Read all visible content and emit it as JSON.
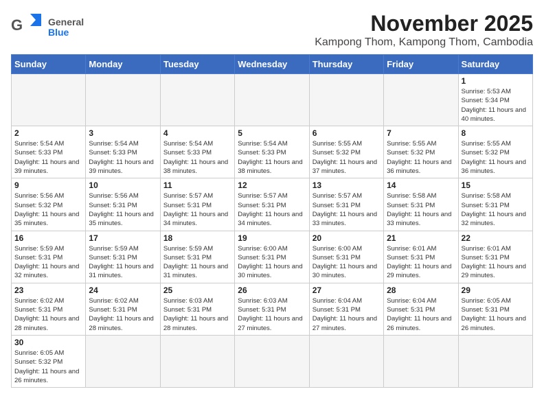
{
  "header": {
    "logo_general": "General",
    "logo_blue": "Blue",
    "title": "November 2025",
    "subtitle": "Kampong Thom, Kampong Thom, Cambodia"
  },
  "days_of_week": [
    "Sunday",
    "Monday",
    "Tuesday",
    "Wednesday",
    "Thursday",
    "Friday",
    "Saturday"
  ],
  "weeks": [
    [
      {
        "day": "",
        "empty": true
      },
      {
        "day": "",
        "empty": true
      },
      {
        "day": "",
        "empty": true
      },
      {
        "day": "",
        "empty": true
      },
      {
        "day": "",
        "empty": true
      },
      {
        "day": "",
        "empty": true
      },
      {
        "day": "1",
        "sunrise": "5:53 AM",
        "sunset": "5:34 PM",
        "daylight": "11 hours and 40 minutes."
      }
    ],
    [
      {
        "day": "2",
        "sunrise": "5:54 AM",
        "sunset": "5:33 PM",
        "daylight": "11 hours and 39 minutes."
      },
      {
        "day": "3",
        "sunrise": "5:54 AM",
        "sunset": "5:33 PM",
        "daylight": "11 hours and 39 minutes."
      },
      {
        "day": "4",
        "sunrise": "5:54 AM",
        "sunset": "5:33 PM",
        "daylight": "11 hours and 38 minutes."
      },
      {
        "day": "5",
        "sunrise": "5:54 AM",
        "sunset": "5:33 PM",
        "daylight": "11 hours and 38 minutes."
      },
      {
        "day": "6",
        "sunrise": "5:55 AM",
        "sunset": "5:32 PM",
        "daylight": "11 hours and 37 minutes."
      },
      {
        "day": "7",
        "sunrise": "5:55 AM",
        "sunset": "5:32 PM",
        "daylight": "11 hours and 36 minutes."
      },
      {
        "day": "8",
        "sunrise": "5:55 AM",
        "sunset": "5:32 PM",
        "daylight": "11 hours and 36 minutes."
      }
    ],
    [
      {
        "day": "9",
        "sunrise": "5:56 AM",
        "sunset": "5:32 PM",
        "daylight": "11 hours and 35 minutes."
      },
      {
        "day": "10",
        "sunrise": "5:56 AM",
        "sunset": "5:31 PM",
        "daylight": "11 hours and 35 minutes."
      },
      {
        "day": "11",
        "sunrise": "5:57 AM",
        "sunset": "5:31 PM",
        "daylight": "11 hours and 34 minutes."
      },
      {
        "day": "12",
        "sunrise": "5:57 AM",
        "sunset": "5:31 PM",
        "daylight": "11 hours and 34 minutes."
      },
      {
        "day": "13",
        "sunrise": "5:57 AM",
        "sunset": "5:31 PM",
        "daylight": "11 hours and 33 minutes."
      },
      {
        "day": "14",
        "sunrise": "5:58 AM",
        "sunset": "5:31 PM",
        "daylight": "11 hours and 33 minutes."
      },
      {
        "day": "15",
        "sunrise": "5:58 AM",
        "sunset": "5:31 PM",
        "daylight": "11 hours and 32 minutes."
      }
    ],
    [
      {
        "day": "16",
        "sunrise": "5:59 AM",
        "sunset": "5:31 PM",
        "daylight": "11 hours and 32 minutes."
      },
      {
        "day": "17",
        "sunrise": "5:59 AM",
        "sunset": "5:31 PM",
        "daylight": "11 hours and 31 minutes."
      },
      {
        "day": "18",
        "sunrise": "5:59 AM",
        "sunset": "5:31 PM",
        "daylight": "11 hours and 31 minutes."
      },
      {
        "day": "19",
        "sunrise": "6:00 AM",
        "sunset": "5:31 PM",
        "daylight": "11 hours and 30 minutes."
      },
      {
        "day": "20",
        "sunrise": "6:00 AM",
        "sunset": "5:31 PM",
        "daylight": "11 hours and 30 minutes."
      },
      {
        "day": "21",
        "sunrise": "6:01 AM",
        "sunset": "5:31 PM",
        "daylight": "11 hours and 29 minutes."
      },
      {
        "day": "22",
        "sunrise": "6:01 AM",
        "sunset": "5:31 PM",
        "daylight": "11 hours and 29 minutes."
      }
    ],
    [
      {
        "day": "23",
        "sunrise": "6:02 AM",
        "sunset": "5:31 PM",
        "daylight": "11 hours and 28 minutes."
      },
      {
        "day": "24",
        "sunrise": "6:02 AM",
        "sunset": "5:31 PM",
        "daylight": "11 hours and 28 minutes."
      },
      {
        "day": "25",
        "sunrise": "6:03 AM",
        "sunset": "5:31 PM",
        "daylight": "11 hours and 28 minutes."
      },
      {
        "day": "26",
        "sunrise": "6:03 AM",
        "sunset": "5:31 PM",
        "daylight": "11 hours and 27 minutes."
      },
      {
        "day": "27",
        "sunrise": "6:04 AM",
        "sunset": "5:31 PM",
        "daylight": "11 hours and 27 minutes."
      },
      {
        "day": "28",
        "sunrise": "6:04 AM",
        "sunset": "5:31 PM",
        "daylight": "11 hours and 26 minutes."
      },
      {
        "day": "29",
        "sunrise": "6:05 AM",
        "sunset": "5:31 PM",
        "daylight": "11 hours and 26 minutes."
      }
    ],
    [
      {
        "day": "30",
        "sunrise": "6:05 AM",
        "sunset": "5:32 PM",
        "daylight": "11 hours and 26 minutes."
      },
      {
        "day": "",
        "empty": true
      },
      {
        "day": "",
        "empty": true
      },
      {
        "day": "",
        "empty": true
      },
      {
        "day": "",
        "empty": true
      },
      {
        "day": "",
        "empty": true
      },
      {
        "day": "",
        "empty": true
      }
    ]
  ],
  "labels": {
    "sunrise": "Sunrise:",
    "sunset": "Sunset:",
    "daylight": "Daylight:"
  }
}
